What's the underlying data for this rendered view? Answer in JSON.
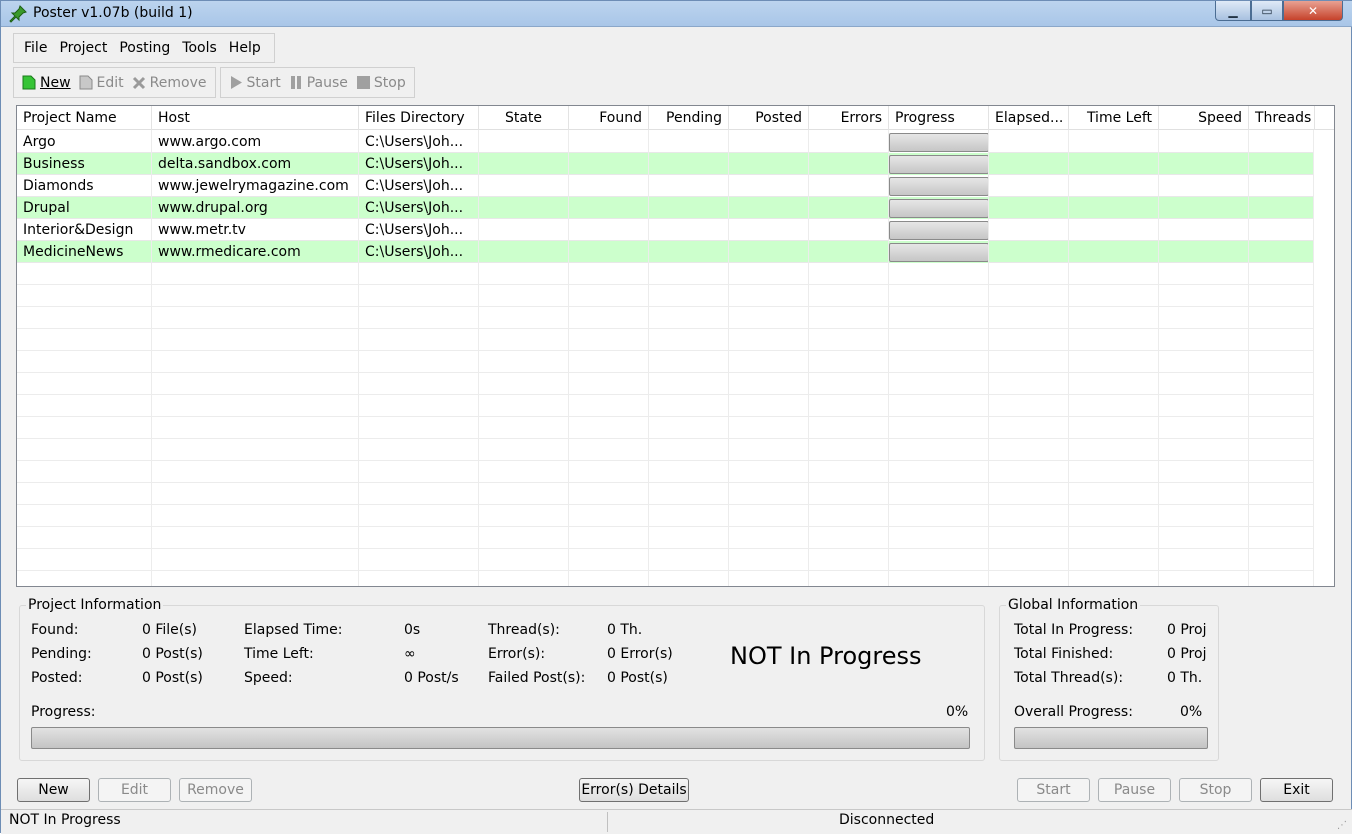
{
  "window": {
    "title": "Poster v1.07b (build 1)",
    "controls": [
      "minimize",
      "maximize",
      "close"
    ]
  },
  "menu": [
    "File",
    "Project",
    "Posting",
    "Tools",
    "Help"
  ],
  "toolbar": {
    "new": "New",
    "edit": "Edit",
    "remove": "Remove",
    "start": "Start",
    "pause": "Pause",
    "stop": "Stop"
  },
  "grid": {
    "columns": [
      "Project Name",
      "Host",
      "Files Directory",
      "State",
      "Found",
      "Pending",
      "Posted",
      "Errors",
      "Progress",
      "Elapsed...",
      "Time Left",
      "Speed",
      "Threads"
    ],
    "rows": [
      {
        "name": "Argo",
        "host": "www.argo.com",
        "dir": "C:\\Users\\Joh..."
      },
      {
        "name": "Business",
        "host": "delta.sandbox.com",
        "dir": "C:\\Users\\Joh..."
      },
      {
        "name": "Diamonds",
        "host": "www.jewelrymagazine.com",
        "dir": "C:\\Users\\Joh..."
      },
      {
        "name": "Drupal",
        "host": "www.drupal.org",
        "dir": "C:\\Users\\Joh..."
      },
      {
        "name": "Interior&Design",
        "host": "www.metr.tv",
        "dir": "C:\\Users\\Joh..."
      },
      {
        "name": "MedicineNews",
        "host": "www.rmedicare.com",
        "dir": "C:\\Users\\Joh..."
      }
    ]
  },
  "project_info": {
    "legend": "Project Information",
    "found_label": "Found:",
    "found_value": "0 File(s)",
    "pending_label": "Pending:",
    "pending_value": "0 Post(s)",
    "posted_label": "Posted:",
    "posted_value": "0 Post(s)",
    "elapsed_label": "Elapsed Time:",
    "elapsed_value": "0s",
    "timeleft_label": "Time Left:",
    "timeleft_value": "∞",
    "speed_label": "Speed:",
    "speed_value": "0 Post/s",
    "threads_label": "Thread(s):",
    "threads_value": "0 Th.",
    "errors_label": "Error(s):",
    "errors_value": "0 Error(s)",
    "failed_label": "Failed Post(s):",
    "failed_value": "0 Post(s)",
    "status": "NOT In Progress",
    "progress_label": "Progress:",
    "progress_value": "0%"
  },
  "global_info": {
    "legend": "Global Information",
    "in_progress_label": "Total In Progress:",
    "in_progress_value": "0 Proj",
    "finished_label": "Total Finished:",
    "finished_value": "0 Proj",
    "threads_label": "Total Thread(s):",
    "threads_value": "0 Th.",
    "overall_label": "Overall Progress:",
    "overall_value": "0%"
  },
  "buttons": {
    "new": "New",
    "edit": "Edit",
    "remove": "Remove",
    "errors": "Error(s) Details",
    "start": "Start",
    "pause": "Pause",
    "stop": "Stop",
    "exit": "Exit"
  },
  "status": {
    "left": "NOT In Progress",
    "right": "Disconnected"
  }
}
